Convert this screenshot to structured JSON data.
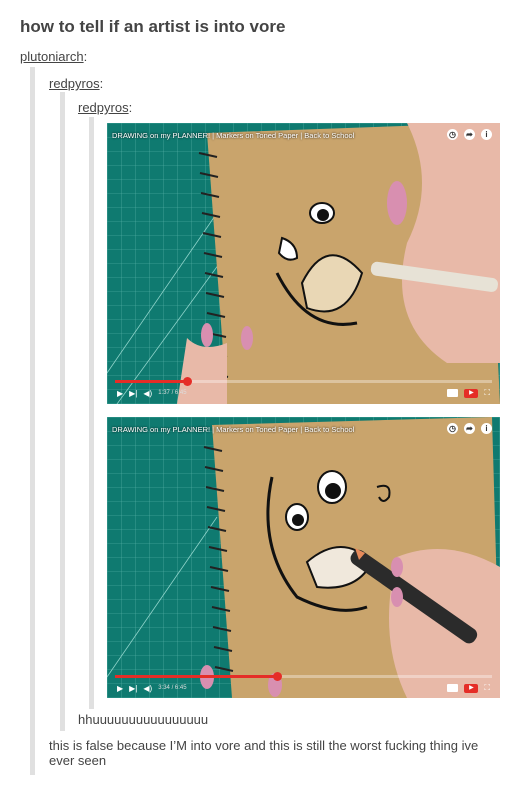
{
  "post": {
    "title": "how to tell if an artist is into vore"
  },
  "reblog_chain": [
    {
      "username": "plutoniarch",
      "colon": ":"
    },
    {
      "username": "redpyros",
      "colon": ":"
    },
    {
      "username": "redpyros",
      "colon": ":"
    }
  ],
  "videos": [
    {
      "title": "DRAWING on my PLANNER! | Markers on Toned Paper | Back to School",
      "time": "1:37 / 6:45",
      "progress": 0.19
    },
    {
      "title": "DRAWING on my PLANNER! | Markers on Toned Paper | Back to School",
      "time": "3:34 / 6:45",
      "progress": 0.43
    }
  ],
  "replies": [
    {
      "text": "hhuuuuuuuuuuuuuuuu"
    },
    {
      "text": "this is false because I’M into vore and this is still the worst fucking thing ive ever seen"
    }
  ],
  "colors": {
    "text": "#444444",
    "quote_bar": "#e0e0e0",
    "cutting_mat": "#0f7a70",
    "paper": "#c9a46c",
    "progress": "#e52d27"
  }
}
